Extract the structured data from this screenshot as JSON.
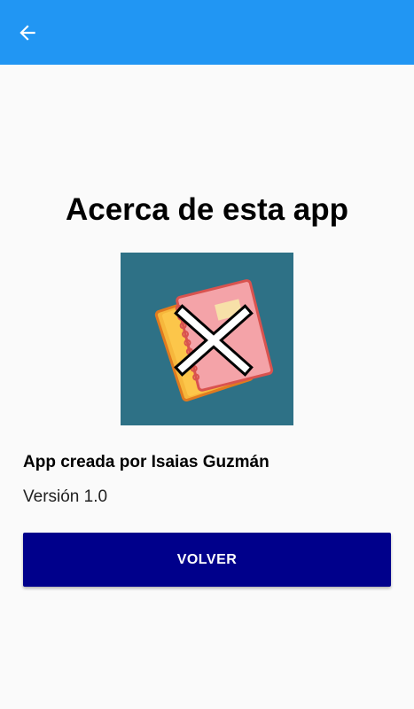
{
  "appbar": {
    "color": "#2196f3",
    "back_icon": "arrow-left-icon"
  },
  "content": {
    "title": "Acerca de esta app",
    "logo_icon": "notebooks-cross-icon",
    "author": "App creada por Isaias Guzmán",
    "version": "Versión 1.0",
    "button_label": "VOLVER",
    "button_color": "#00008b"
  }
}
